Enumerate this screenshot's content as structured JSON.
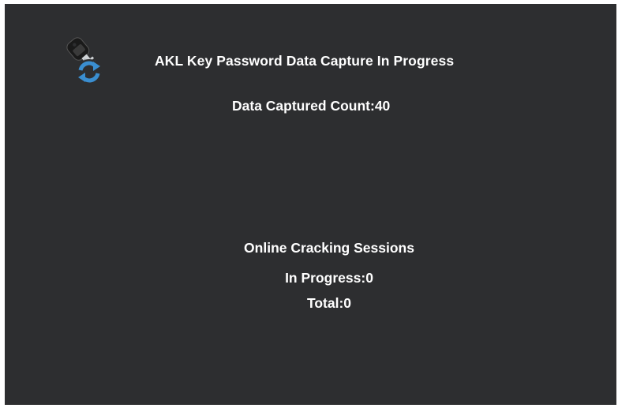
{
  "icons": {
    "status_icon": "key-with-refresh-icon"
  },
  "colors": {
    "background": "#2d2e30",
    "text": "#ffffff",
    "icon_blue": "#3a8ed0"
  },
  "status": {
    "headline": "AKL Key Password Data Capture In Progress",
    "captured_label": "Data Captured Count:",
    "captured_value": "40"
  },
  "sessions": {
    "title": "Online Cracking Sessions",
    "in_progress_label": "In Progress:",
    "in_progress_value": "0",
    "total_label": "Total:",
    "total_value": "0"
  }
}
